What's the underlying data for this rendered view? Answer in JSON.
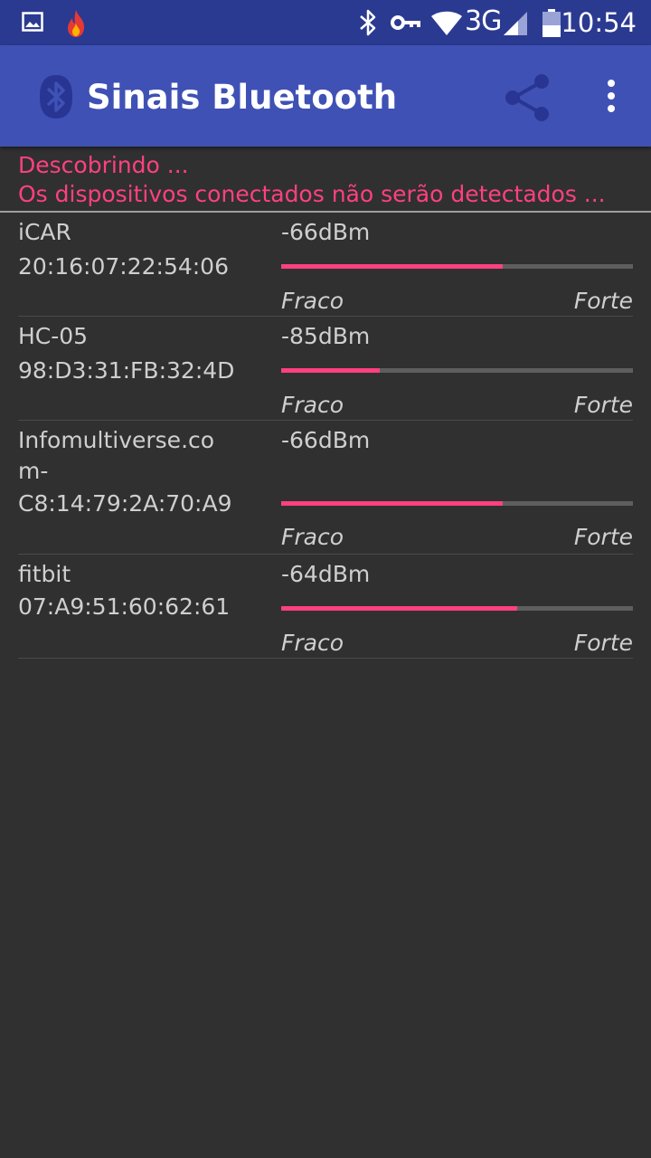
{
  "status_bar": {
    "time": "10:54",
    "network": "3G",
    "icons": [
      "image-icon",
      "flame-icon",
      "bluetooth-icon",
      "vpn-key-icon",
      "wifi-icon",
      "signal-icon",
      "battery-icon"
    ]
  },
  "app_bar": {
    "title": "Sinais Bluetooth",
    "icons": [
      "bluetooth-logo-icon",
      "share-icon",
      "overflow-menu-icon"
    ]
  },
  "discovery": {
    "line1": "Descobrindo ...",
    "line2": "Os dispositivos conectados não serão detectados ..."
  },
  "colors": {
    "accent": "#ff4081",
    "primary": "#3f51b5",
    "primary_dark": "#2b3a91",
    "background": "#303030"
  },
  "devices": [
    {
      "name_lines": [
        "iCAR",
        "20:16:07:22:54:06"
      ],
      "signal": "-66dBm",
      "strength": 0.63,
      "weak_label": "Fraco",
      "strong_label": "Forte"
    },
    {
      "name_lines": [
        "HC-05",
        "98:D3:31:FB:32:4D"
      ],
      "signal": "-85dBm",
      "strength": 0.28,
      "weak_label": "Fraco",
      "strong_label": "Forte"
    },
    {
      "name_lines": [
        "Infomultiverse.co",
        "m-",
        "C8:14:79:2A:70:A9"
      ],
      "signal": "-66dBm",
      "strength": 0.63,
      "weak_label": "Fraco",
      "strong_label": "Forte"
    },
    {
      "name_lines": [
        "fitbit",
        "07:A9:51:60:62:61"
      ],
      "signal": "-64dBm",
      "strength": 0.67,
      "weak_label": "Fraco",
      "strong_label": "Forte"
    }
  ]
}
